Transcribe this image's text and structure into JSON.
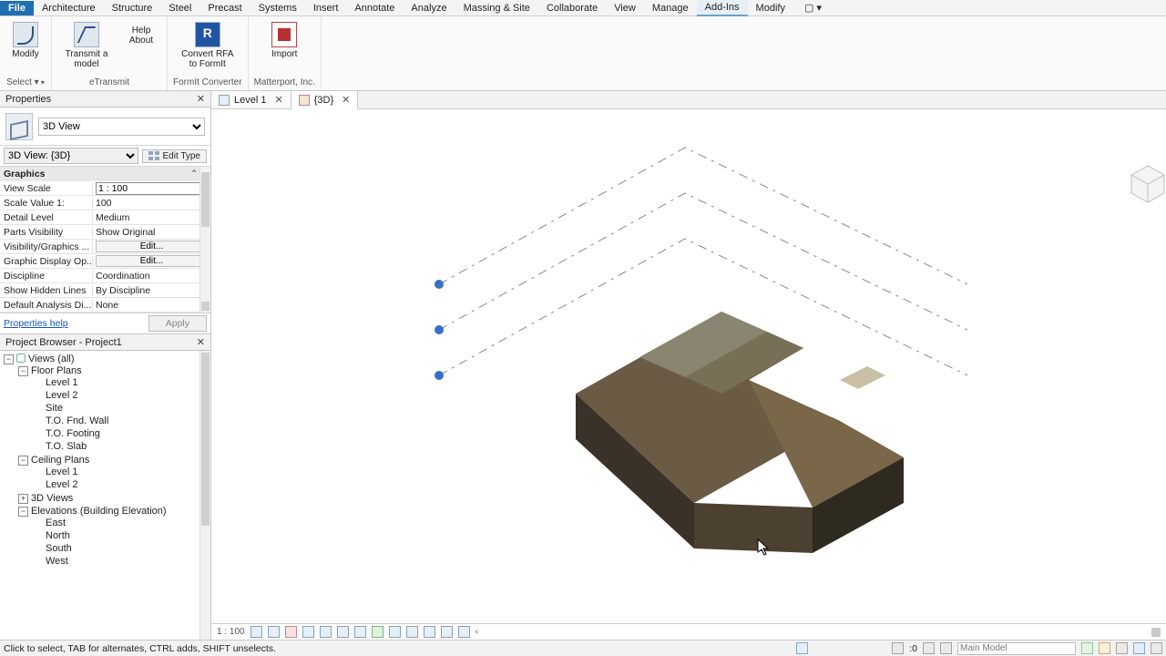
{
  "menu": {
    "file": "File",
    "tabs": [
      "Architecture",
      "Structure",
      "Steel",
      "Precast",
      "Systems",
      "Insert",
      "Annotate",
      "Analyze",
      "Massing & Site",
      "Collaborate",
      "View",
      "Manage",
      "Add-Ins",
      "Modify"
    ],
    "active_tab": "Add-Ins",
    "help_marker": "⌄"
  },
  "ribbon": {
    "groups": [
      {
        "label": "Select ▾",
        "buttons": [
          {
            "icon": "modify",
            "text": "Modify"
          }
        ]
      },
      {
        "label": "eTransmit",
        "buttons": [
          {
            "icon": "arrow",
            "text": "Transmit a model"
          },
          {
            "icon": "plain",
            "text": "Help\nAbout",
            "small": true
          }
        ]
      },
      {
        "label": "FormIt Converter",
        "buttons": [
          {
            "icon": "blue",
            "text": "Convert RFA\nto FormIt"
          }
        ]
      },
      {
        "label": "Matterport, Inc.",
        "buttons": [
          {
            "icon": "red",
            "text": "Import"
          }
        ]
      }
    ]
  },
  "properties": {
    "panel_title": "Properties",
    "type_name": "3D View",
    "instance_selector": "3D View: {3D}",
    "edit_type": "Edit Type",
    "section": "Graphics",
    "rows": [
      {
        "k": "View Scale",
        "v": "1 : 100",
        "input": true
      },
      {
        "k": "Scale Value    1:",
        "v": "100"
      },
      {
        "k": "Detail Level",
        "v": "Medium"
      },
      {
        "k": "Parts Visibility",
        "v": "Show Original"
      },
      {
        "k": "Visibility/Graphics ...",
        "v": "Edit...",
        "btn": true
      },
      {
        "k": "Graphic Display Op...",
        "v": "Edit...",
        "btn": true
      },
      {
        "k": "Discipline",
        "v": "Coordination"
      },
      {
        "k": "Show Hidden Lines",
        "v": "By Discipline"
      },
      {
        "k": "Default Analysis Di...",
        "v": "None"
      }
    ],
    "help_link": "Properties help",
    "apply": "Apply"
  },
  "browser": {
    "title": "Project Browser - Project1",
    "tree": {
      "root": "Views (all)",
      "groups": [
        {
          "name": "Floor Plans",
          "open": true,
          "items": [
            "Level 1",
            "Level 2",
            "Site",
            "T.O. Fnd. Wall",
            "T.O. Footing",
            "T.O. Slab"
          ]
        },
        {
          "name": "Ceiling Plans",
          "open": true,
          "items": [
            "Level 1",
            "Level 2"
          ]
        },
        {
          "name": "3D Views",
          "open": false,
          "items": []
        },
        {
          "name": "Elevations (Building Elevation)",
          "open": true,
          "items": [
            "East",
            "North",
            "South",
            "West"
          ]
        }
      ]
    }
  },
  "view_tabs": [
    {
      "label": "Level 1",
      "kind": "plan"
    },
    {
      "label": "{3D}",
      "kind": "home",
      "active": true
    }
  ],
  "view_controls": {
    "scale": "1 : 100"
  },
  "status": {
    "hint": "Click to select, TAB for alternates, CTRL adds, SHIFT unselects.",
    "count": ":0",
    "workset": "Main Model"
  }
}
